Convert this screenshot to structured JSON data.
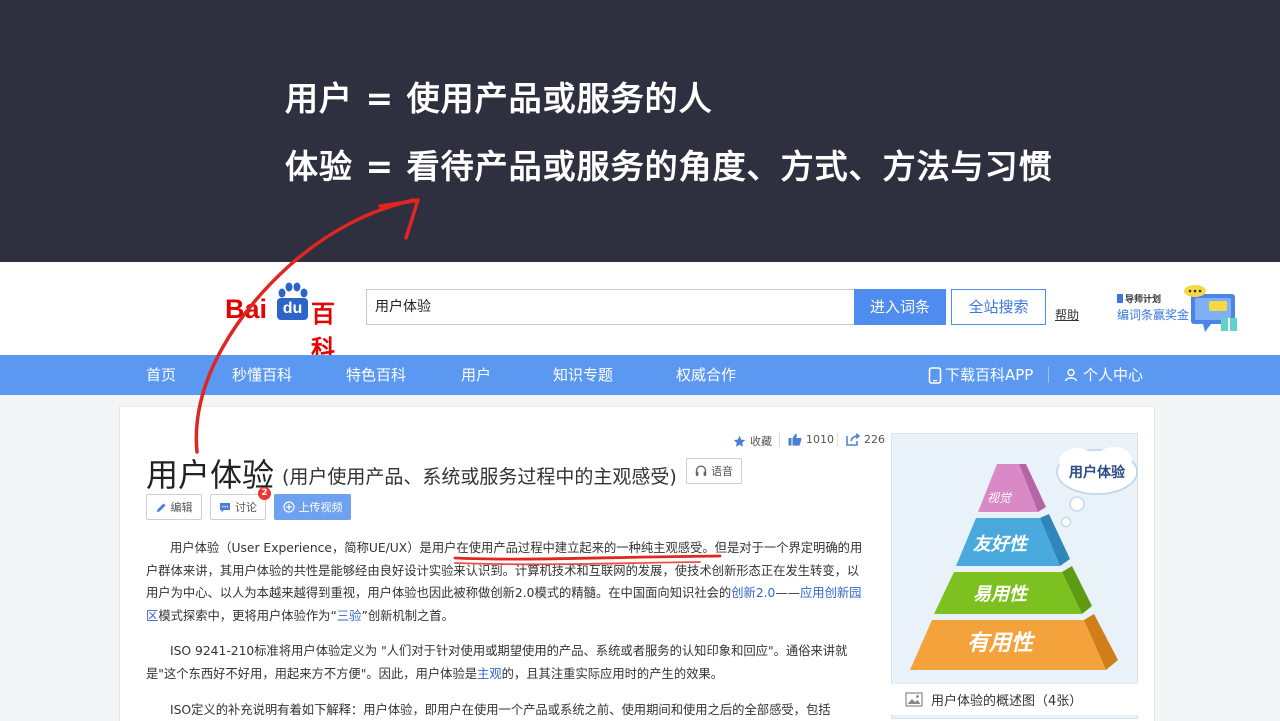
{
  "slide": {
    "line1": "用户 = 使用产品或服务的人",
    "line2": "体验 = 看待产品或服务的角度、方式、方法与习惯"
  },
  "header": {
    "logo_bai": "Bai",
    "logo_du": "du",
    "logo_ke": "百科",
    "search_value": "用户体验",
    "enter_label": "进入词条",
    "site_search_label": "全站搜索",
    "help_label": "帮助",
    "promo_line1": "导师计划",
    "promo_line2": "编词条赢奖金"
  },
  "nav": {
    "items": [
      "首页",
      "秒懂百科",
      "特色百科",
      "用户",
      "知识专题",
      "权威合作"
    ],
    "download_app": "下载百科APP",
    "personal_center": "个人中心"
  },
  "article": {
    "stats": {
      "collect_label": "收藏",
      "likes": "1010",
      "shares": "226"
    },
    "title": "用户体验",
    "subtitle": "(用户使用产品、系统或服务过程中的主观感受)",
    "voice_label": "语音",
    "edit_label": "编辑",
    "discuss_label": "讨论",
    "discuss_badge": "2",
    "upload_label": "上传视频",
    "p1_a": "用户体验（User Experience，简称UE/UX）是用户",
    "p1_b": "在使用产品过程中建立起来的一种纯主观感受",
    "p1_c": "。但是对于一个界定明确的用户群体来讲，其用户体验的共性是能够经由良好设计实验来认识到。计算机技术和互联网的发展，使技术创新形态正在发生转变，以用户为中心、以人为本越来越得到重视，用户体验也因此被称做创新2.0模式的精髓。在中国面向知识社会的",
    "p1_link1": "创新2.0",
    "p1_d": "——",
    "p1_link2": "应用创新园区",
    "p1_e": "模式探索中，更将用户体验作为“",
    "p1_link3": "三验",
    "p1_f": "”创新机制之首。",
    "p2_a": "ISO 9241-210标准将用户体验定义为 \"人们对于针对使用或期望使用的产品、系统或者服务的认知印象和回应\"。通俗来讲就是\"这个东西好不好用，用起来方不方便\"。因此，用户体验是",
    "p2_link": "主观",
    "p2_b": "的，且其注重实际应用时的产生的效果。",
    "p3": "ISO定义的补充说明有着如下解释：用户体验，即用户在使用一个产品或系统之前、使用期间和使用之后的全部感受，包括"
  },
  "sidebar_picture": {
    "cloud_label": "用户体验",
    "levels": [
      "视觉",
      "友好性",
      "易用性",
      "有用性"
    ],
    "caption": "用户体验的概述图",
    "count": "（4张）"
  },
  "colors": {
    "slide_bg": "#2e3040",
    "nav_bg": "#5b98f2",
    "brand_red": "#e10602",
    "brand_blue": "#2d64c8",
    "annotation_red": "#e0261f"
  }
}
